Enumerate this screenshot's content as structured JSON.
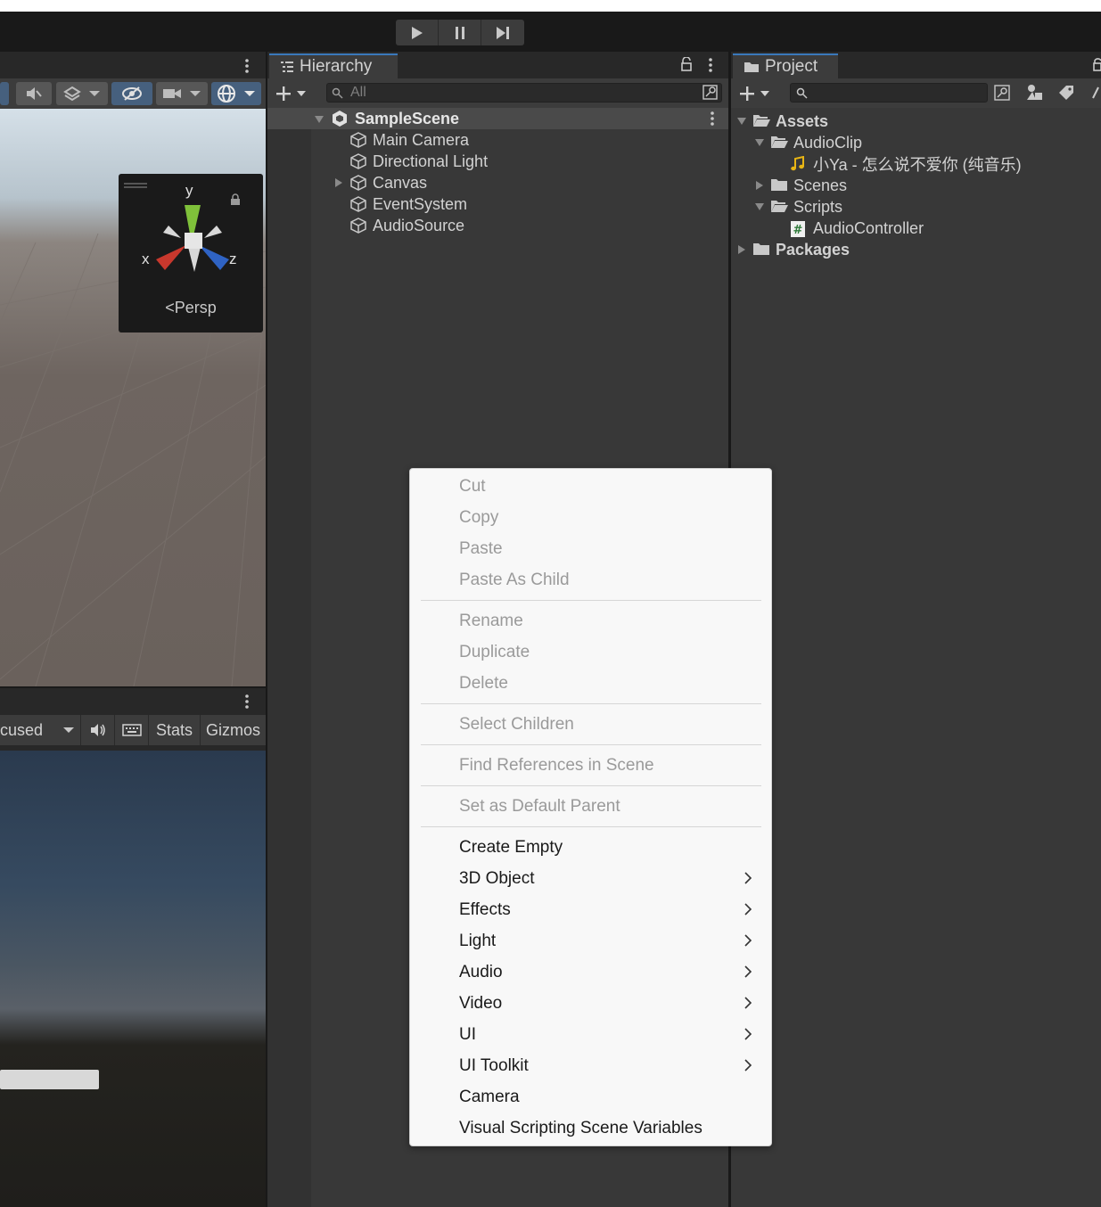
{
  "app": {
    "play_controls": [
      "play",
      "pause",
      "step"
    ]
  },
  "scene_view": {
    "gizmo": {
      "axis_y": "y",
      "axis_x": "x",
      "axis_z": "z",
      "mode": "Persp"
    }
  },
  "game_view": {
    "display_dropdown": "cused",
    "stats_label": "Stats",
    "gizmos_label": "Gizmos"
  },
  "hierarchy": {
    "tab_title": "Hierarchy",
    "search_placeholder": "All",
    "scene_name": "SampleScene",
    "items": [
      {
        "label": "Main Camera",
        "expandable": false
      },
      {
        "label": "Directional Light",
        "expandable": false
      },
      {
        "label": "Canvas",
        "expandable": true
      },
      {
        "label": "EventSystem",
        "expandable": false
      },
      {
        "label": "AudioSource",
        "expandable": false
      }
    ]
  },
  "project": {
    "tab_title": "Project",
    "search_placeholder": "",
    "tree": [
      {
        "label": "Assets",
        "bold": true
      },
      {
        "label": "AudioClip"
      },
      {
        "label": "小Ya - 怎么说不爱你 (纯音乐)"
      },
      {
        "label": "Scenes"
      },
      {
        "label": "Scripts"
      },
      {
        "label": "AudioController"
      },
      {
        "label": "Packages",
        "bold": true
      }
    ]
  },
  "context_menu": {
    "items": [
      {
        "label": "Cut",
        "enabled": false
      },
      {
        "label": "Copy",
        "enabled": false
      },
      {
        "label": "Paste",
        "enabled": false
      },
      {
        "label": "Paste As Child",
        "enabled": false
      },
      {
        "label": "Rename",
        "enabled": false
      },
      {
        "label": "Duplicate",
        "enabled": false
      },
      {
        "label": "Delete",
        "enabled": false
      },
      {
        "label": "Select Children",
        "enabled": false
      },
      {
        "label": "Find References in Scene",
        "enabled": false
      },
      {
        "label": "Set as Default Parent",
        "enabled": false
      },
      {
        "label": "Create Empty",
        "enabled": true
      },
      {
        "label": "3D Object",
        "enabled": true,
        "submenu": true
      },
      {
        "label": "Effects",
        "enabled": true,
        "submenu": true
      },
      {
        "label": "Light",
        "enabled": true,
        "submenu": true
      },
      {
        "label": "Audio",
        "enabled": true,
        "submenu": true
      },
      {
        "label": "Video",
        "enabled": true,
        "submenu": true
      },
      {
        "label": "UI",
        "enabled": true,
        "submenu": true
      },
      {
        "label": "UI Toolkit",
        "enabled": true,
        "submenu": true
      },
      {
        "label": "Camera",
        "enabled": true
      },
      {
        "label": "Visual Scripting Scene Variables",
        "enabled": true
      }
    ]
  },
  "colors": {
    "editor_bg": "#383838",
    "toolbar_bg": "#191919",
    "accent": "#3a79bb",
    "menu_bg": "#f8f8f8",
    "menu_disabled": "#9a9a9a"
  }
}
